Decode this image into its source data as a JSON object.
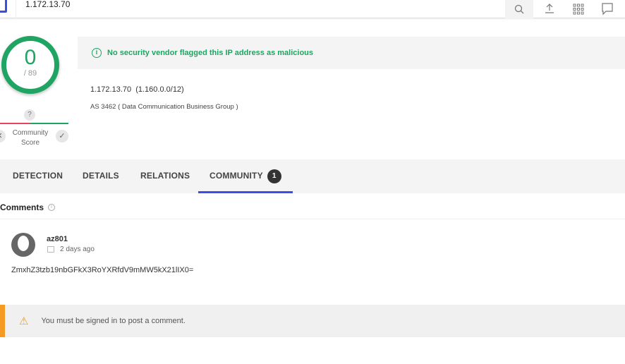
{
  "topbar": {
    "search_value": "1.172.13.70",
    "icons": [
      "search-icon",
      "upload-icon",
      "apps-grid-icon",
      "chat-icon"
    ]
  },
  "score": {
    "value": "0",
    "total": "/ 89",
    "color": "#1fa463"
  },
  "community_score": {
    "question": "?",
    "label": "Community Score",
    "upvote": "✓",
    "downvote": "✕"
  },
  "banner": {
    "icon": "i",
    "text": "No security vendor flagged this IP address as malicious"
  },
  "info": {
    "ip": "1.172.13.70  (1.160.0.0/12)",
    "as": "AS 3462 ( Data Communication Business Group )"
  },
  "tabs": [
    {
      "label": "DETECTION"
    },
    {
      "label": "DETAILS"
    },
    {
      "label": "RELATIONS"
    },
    {
      "label": "COMMUNITY",
      "badge": "1",
      "active": true
    }
  ],
  "comments": {
    "title": "Comments",
    "info_icon": "i",
    "items": [
      {
        "user": "az801",
        "date": "2 days ago",
        "text": "ZmxhZ3tzb19nbGFkX3RoYXRfdV9mMW5kX21lIX0="
      }
    ]
  },
  "signin": {
    "icon": "⚠",
    "text": "You must be signed in to post a comment.",
    "accent": "#f59a23"
  }
}
